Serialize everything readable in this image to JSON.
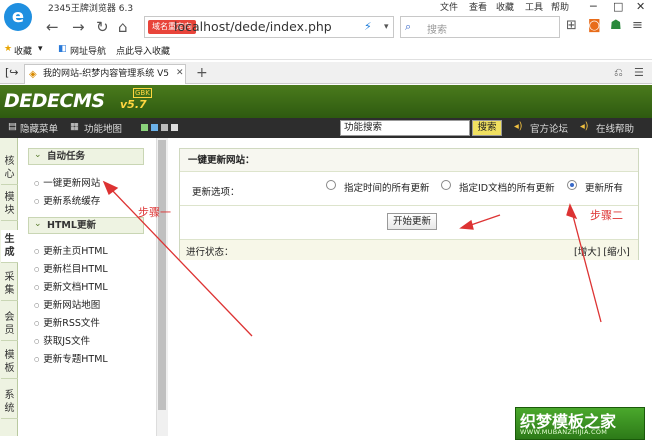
{
  "browser": {
    "app_title": "2345王牌浏览器 6.3",
    "menu": [
      "文件",
      "查看",
      "收藏",
      "工具",
      "帮助"
    ],
    "promo": "域名重定向",
    "url": "localhost/dede/index.php",
    "search_placeholder": "搜索",
    "bookmarks": [
      "收藏",
      "网址导航",
      "点此导入收藏"
    ],
    "tab_title": "我的网站-织梦内容管理系统 V5"
  },
  "cms": {
    "logo": "DEDECMS",
    "version": "v5.7",
    "badge": "GBK",
    "toolbar": {
      "hide_menu": "隐藏菜单",
      "function_map": "功能地图",
      "search_value": "功能搜索",
      "search_btn": "搜索",
      "forum": "官方论坛",
      "help": "在线帮助"
    },
    "left_tabs": [
      "核心",
      "模块",
      "生成",
      "采集",
      "会员",
      "模板",
      "系统"
    ],
    "sidebar": {
      "section1": "自动任务",
      "section1_items": [
        "一键更新网站",
        "更新系统缓存"
      ],
      "section2": "HTML更新",
      "section2_items": [
        "更新主页HTML",
        "更新栏目HTML",
        "更新文档HTML",
        "更新网站地图",
        "更新RSS文件",
        "获取JS文件",
        "更新专题HTML"
      ]
    },
    "main": {
      "title": "一键更新网站：",
      "options_label": "更新选项：",
      "option1": "指定时间的所有更新",
      "option2": "指定ID文档的所有更新",
      "option3": "更新所有",
      "start_button": "开始更新",
      "status_label": "进行状态：",
      "zoom": "[增大] [缩小]"
    }
  },
  "annotations": {
    "step1": "步骤一",
    "step2": "步骤二"
  },
  "watermark": {
    "title": "织梦模板之家",
    "url": "WWW.MUBANZHIJIA.COM"
  }
}
